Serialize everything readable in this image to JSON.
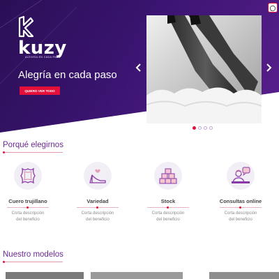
{
  "hero": {
    "brand_name": "kuzy",
    "brand_tagline": "ALEGRÍA EN CADA PASO",
    "headline": "Alegría en cada paso",
    "cta_label": "QUIERO VER TODO",
    "active_slide": 1,
    "slide_count": 4
  },
  "section_why": {
    "title": "Porqué elegirnos",
    "features": [
      {
        "icon": "leather-hide-icon",
        "title": "Cuero trujillano",
        "desc": [
          "Corta descripción",
          "del beneficio"
        ]
      },
      {
        "icon": "high-heel-icon",
        "title": "Variedad",
        "desc": [
          "Corta descripción",
          "del beneficio"
        ]
      },
      {
        "icon": "boxes-stock-icon",
        "title": "Stock",
        "desc": [
          "Corta descripción",
          "del beneficio"
        ]
      },
      {
        "icon": "online-support-icon",
        "title": "Consultas online",
        "desc": [
          "Corta descripción",
          "del beneficio"
        ]
      }
    ]
  },
  "section_models": {
    "title": "Nuestro modelos"
  },
  "colors": {
    "accent": "#e4103a",
    "hero_purple": "#3a1470",
    "section_title": "#6b2a92"
  }
}
